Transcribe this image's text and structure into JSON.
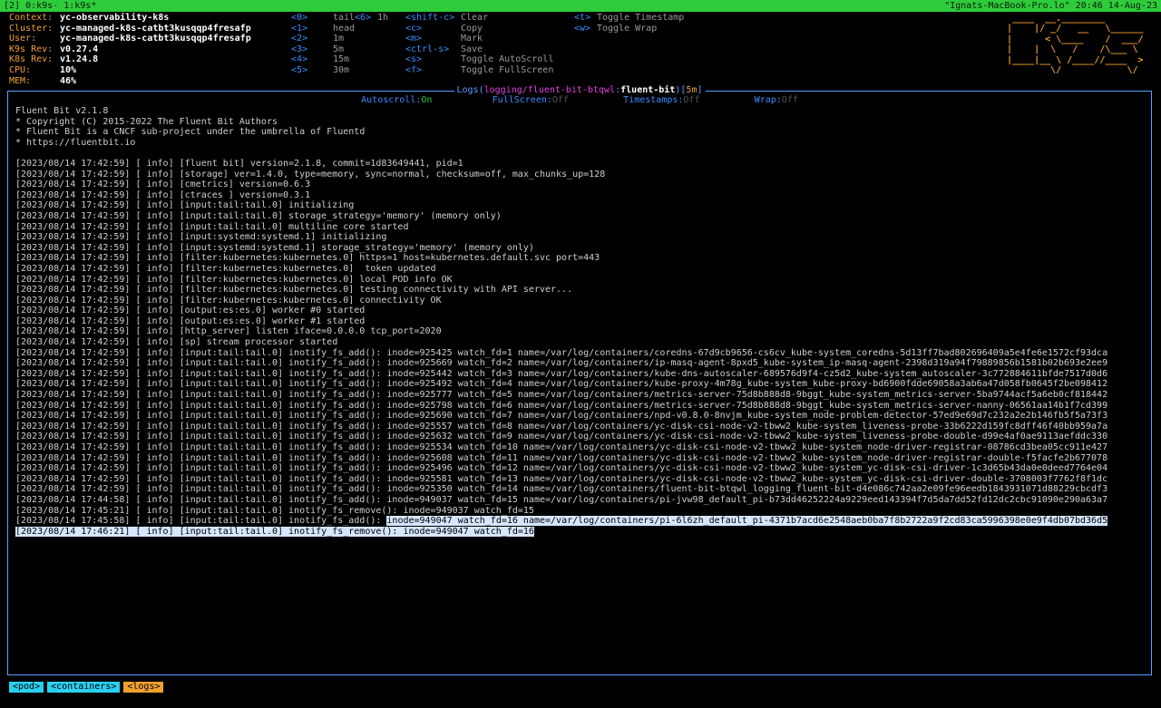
{
  "tmux": {
    "left": "[2] 0:k9s- 1:k9s*",
    "right": "\"Ignats-MacBook-Pro.lo\" 20:46 14-Aug-23"
  },
  "info": [
    {
      "key": "Context:",
      "value": "yc-observability-k8s"
    },
    {
      "key": "Cluster:",
      "value": "yc-managed-k8s-catbt3kusqqp4fresafp"
    },
    {
      "key": "User:",
      "value": "yc-managed-k8s-catbt3kusqqp4fresafp"
    },
    {
      "key": "K9s Rev:",
      "value": "v0.27.4"
    },
    {
      "key": "K8s Rev:",
      "value": "v1.24.8"
    },
    {
      "key": "CPU:",
      "value": "10%"
    },
    {
      "key": "MEM:",
      "value": "46%"
    }
  ],
  "keys_col1": [
    {
      "key": "<0>",
      "desc": "tail"
    },
    {
      "key": "<1>",
      "desc": "head"
    },
    {
      "key": "<2>",
      "desc": "1m"
    },
    {
      "key": "<3>",
      "desc": "5m"
    },
    {
      "key": "<4>",
      "desc": "15m"
    },
    {
      "key": "<5>",
      "desc": "30m"
    }
  ],
  "keys_col2": [
    {
      "key": "<6>",
      "desc": "1h"
    }
  ],
  "keys_col3": [
    {
      "key": "<shift-c>",
      "desc": "Clear"
    },
    {
      "key": "<c>",
      "desc": "Copy"
    },
    {
      "key": "<m>",
      "desc": "Mark"
    },
    {
      "key": "<ctrl-s>",
      "desc": "Save"
    },
    {
      "key": "<s>",
      "desc": "Toggle AutoScroll"
    },
    {
      "key": "<f>",
      "desc": "Toggle FullScreen"
    }
  ],
  "keys_col4": [
    {
      "key": "<t>",
      "desc": "Toggle Timestamp"
    },
    {
      "key": "<w>",
      "desc": "Toggle Wrap"
    }
  ],
  "logo": [
    " ____  __.________       ",
    "|    |/ _/   __   \\______",
    "|      < \\____    /  ___/",
    "|    |  \\   /    /\\___ \\ ",
    "|____|__ \\ /____//____  >",
    "        \\/            \\/ "
  ],
  "panel": {
    "title_prefix": "Logs(",
    "namespace": "logging/fluent-bit-btqwl",
    "container": "fluent-bit",
    "duration": "5m",
    "title_suffix": ")"
  },
  "toggles": {
    "autoscroll_label": "Autoscroll:",
    "autoscroll_value": "On",
    "fullscreen_label": "FullScreen:",
    "fullscreen_value": "Off",
    "timestamps_label": "Timestamps:",
    "timestamps_value": "Off",
    "wrap_label": "Wrap:",
    "wrap_value": "Off"
  },
  "log_lines": [
    "Fluent Bit v2.1.8",
    "* Copyright (C) 2015-2022 The Fluent Bit Authors",
    "* Fluent Bit is a CNCF sub-project under the umbrella of Fluentd",
    "* https://fluentbit.io",
    "",
    "[2023/08/14 17:42:59] [ info] [fluent bit] version=2.1.8, commit=1d83649441, pid=1",
    "[2023/08/14 17:42:59] [ info] [storage] ver=1.4.0, type=memory, sync=normal, checksum=off, max_chunks_up=128",
    "[2023/08/14 17:42:59] [ info] [cmetrics] version=0.6.3",
    "[2023/08/14 17:42:59] [ info] [ctraces ] version=0.3.1",
    "[2023/08/14 17:42:59] [ info] [input:tail:tail.0] initializing",
    "[2023/08/14 17:42:59] [ info] [input:tail:tail.0] storage_strategy='memory' (memory only)",
    "[2023/08/14 17:42:59] [ info] [input:tail:tail.0] multiline core started",
    "[2023/08/14 17:42:59] [ info] [input:systemd:systemd.1] initializing",
    "[2023/08/14 17:42:59] [ info] [input:systemd:systemd.1] storage_strategy='memory' (memory only)",
    "[2023/08/14 17:42:59] [ info] [filter:kubernetes:kubernetes.0] https=1 host=kubernetes.default.svc port=443",
    "[2023/08/14 17:42:59] [ info] [filter:kubernetes:kubernetes.0]  token updated",
    "[2023/08/14 17:42:59] [ info] [filter:kubernetes:kubernetes.0] local POD info OK",
    "[2023/08/14 17:42:59] [ info] [filter:kubernetes:kubernetes.0] testing connectivity with API server...",
    "[2023/08/14 17:42:59] [ info] [filter:kubernetes:kubernetes.0] connectivity OK",
    "[2023/08/14 17:42:59] [ info] [output:es:es.0] worker #0 started",
    "[2023/08/14 17:42:59] [ info] [output:es:es.0] worker #1 started",
    "[2023/08/14 17:42:59] [ info] [http_server] listen iface=0.0.0.0 tcp_port=2020",
    "[2023/08/14 17:42:59] [ info] [sp] stream processor started",
    "[2023/08/14 17:42:59] [ info] [input:tail:tail.0] inotify_fs_add(): inode=925425 watch_fd=1 name=/var/log/containers/coredns-67d9cb9656-cs6cv_kube-system_coredns-5d13ff7bad802696409a5e4fe6e1572cf93dca",
    "[2023/08/14 17:42:59] [ info] [input:tail:tail.0] inotify_fs_add(): inode=925669 watch_fd=2 name=/var/log/containers/ip-masq-agent-8pxd5_kube-system_ip-masq-agent-2398d319a94f79889856b1581b02b693e2ee9",
    "[2023/08/14 17:42:59] [ info] [input:tail:tail.0] inotify_fs_add(): inode=925442 watch_fd=3 name=/var/log/containers/kube-dns-autoscaler-689576d9f4-cz5d2_kube-system_autoscaler-3c772884611bfde7517d0d6",
    "[2023/08/14 17:42:59] [ info] [input:tail:tail.0] inotify_fs_add(): inode=925492 watch_fd=4 name=/var/log/containers/kube-proxy-4m78g_kube-system_kube-proxy-bd6900fdde69058a3ab6a47d058fb0645f2be098412",
    "[2023/08/14 17:42:59] [ info] [input:tail:tail.0] inotify_fs_add(): inode=925777 watch_fd=5 name=/var/log/containers/metrics-server-75d8b888d8-9bggt_kube-system_metrics-server-5ba9744acf5a6eb0cf818442",
    "[2023/08/14 17:42:59] [ info] [input:tail:tail.0] inotify_fs_add(): inode=925798 watch_fd=6 name=/var/log/containers/metrics-server-75d8b888d8-9bggt_kube-system_metrics-server-nanny-06561aa14b1f7cd399",
    "[2023/08/14 17:42:59] [ info] [input:tail:tail.0] inotify_fs_add(): inode=925690 watch_fd=7 name=/var/log/containers/npd-v0.8.0-8nvjm_kube-system_node-problem-detector-57ed9e69d7c232a2e2b146fb5f5a73f3",
    "[2023/08/14 17:42:59] [ info] [input:tail:tail.0] inotify_fs_add(): inode=925557 watch_fd=8 name=/var/log/containers/yc-disk-csi-node-v2-tbww2_kube-system_liveness-probe-33b6222d159fc8dff46f40bb959a7a",
    "[2023/08/14 17:42:59] [ info] [input:tail:tail.0] inotify_fs_add(): inode=925632 watch_fd=9 name=/var/log/containers/yc-disk-csi-node-v2-tbww2_kube-system_liveness-probe-double-d99e4af0ae9113aefddc330",
    "[2023/08/14 17:42:59] [ info] [input:tail:tail.0] inotify_fs_add(): inode=925534 watch_fd=10 name=/var/log/containers/yc-disk-csi-node-v2-tbww2_kube-system_node-driver-registrar-08786cd3bea05cc911e427",
    "[2023/08/14 17:42:59] [ info] [input:tail:tail.0] inotify_fs_add(): inode=925608 watch_fd=11 name=/var/log/containers/yc-disk-csi-node-v2-tbww2_kube-system_node-driver-registrar-double-f5facfe2b677078",
    "[2023/08/14 17:42:59] [ info] [input:tail:tail.0] inotify_fs_add(): inode=925496 watch_fd=12 name=/var/log/containers/yc-disk-csi-node-v2-tbww2_kube-system_yc-disk-csi-driver-1c3d65b43da0e0deed7764e04",
    "[2023/08/14 17:42:59] [ info] [input:tail:tail.0] inotify_fs_add(): inode=925581 watch_fd=13 name=/var/log/containers/yc-disk-csi-node-v2-tbww2_kube-system_yc-disk-csi-driver-double-3708003f7762f8f1dc",
    "[2023/08/14 17:42:59] [ info] [input:tail:tail.0] inotify_fs_add(): inode=925350 watch_fd=14 name=/var/log/containers/fluent-bit-btqwl_logging_fluent-bit-d4e086c742aa2e09fe96eedb1843931071d88229cbcdf3",
    "[2023/08/14 17:44:58] [ info] [input:tail:tail.0] inotify_fs_add(): inode=949037 watch_fd=15 name=/var/log/containers/pi-jvw98_default_pi-b73dd46252224a9229eed143394f7d5da7dd52fd12dc2cbc91090e290a63a7",
    "[2023/08/14 17:45:21] [ info] [input:tail:tail.0] inotify_fs_remove(): inode=949037 watch_fd=15"
  ],
  "highlight_line_a_pre": "[2023/08/14 17:45:58] [ info] [input:tail:tail.0] inotify_fs_add(): ",
  "highlight_line_a_sel": "inode=949047 watch_fd=16 name=/var/log/containers/pi-6l6zh_default_pi-4371b7acd6e2548aeb0ba7f8b2722a9f2cd83ca5996398e0e9f4db07bd36d5",
  "highlight_line_b": "[2023/08/14 17:46:21] [ info] [input:tail:tail.0] inotify_fs_remove(): inode=949047 watch_fd=16",
  "crumbs": [
    "<pod>",
    "<containers>",
    "<logs>"
  ]
}
